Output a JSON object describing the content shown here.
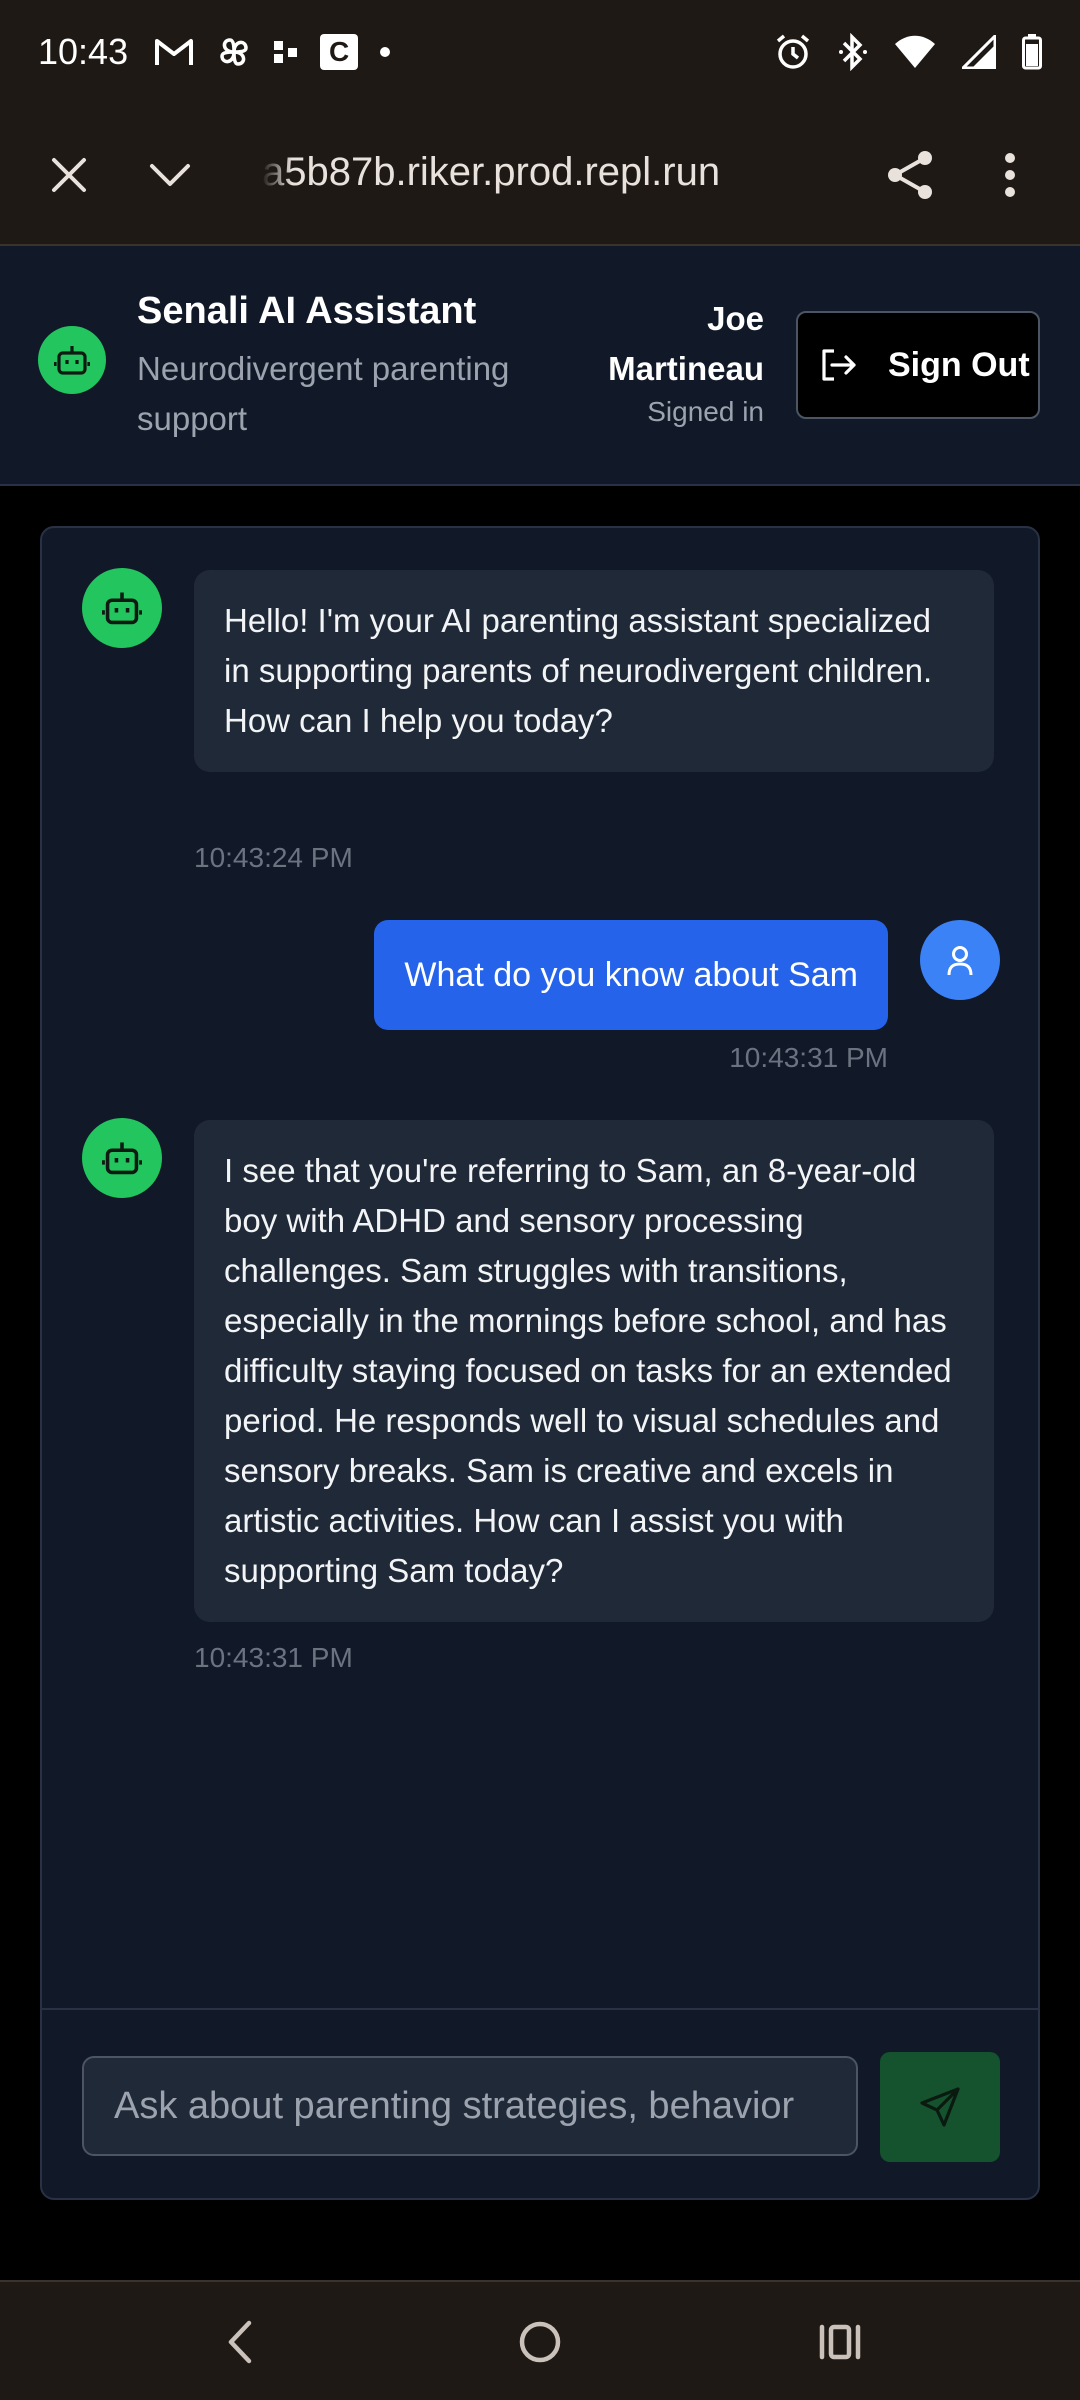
{
  "status_bar": {
    "time": "10:43",
    "left_icons": [
      "gmail-icon",
      "pinwheel-icon",
      "dots-app-icon",
      "c-app-icon",
      "notification-dot-icon"
    ],
    "c_app_letter": "C",
    "right_icons": [
      "alarm-icon",
      "bluetooth-icon",
      "wifi-icon",
      "signal-icon",
      "battery-icon"
    ]
  },
  "browser": {
    "url": "a5b87b.riker.prod.repl.run",
    "close_icon": "close-icon",
    "tabs_icon": "chevron-down-icon",
    "share_icon": "share-icon",
    "menu_icon": "more-vert-icon"
  },
  "header": {
    "title": "Senali AI Assistant",
    "subtitle": "Neurodivergent parenting support",
    "user_name": "Joe Martineau",
    "user_status": "Signed in",
    "sign_out_label": "Sign Out"
  },
  "messages": [
    {
      "role": "assistant",
      "text": "Hello! I'm your AI parenting assistant specialized in supporting parents of neurodivergent children. How can I help you today?",
      "time": "10:43:24 PM"
    },
    {
      "role": "user",
      "text": "What do you know about Sam",
      "time": "10:43:31 PM"
    },
    {
      "role": "assistant",
      "text": "I see that you're referring to Sam, an 8-year-old boy with ADHD and sensory processing challenges. Sam struggles with transitions, especially in the mornings before school, and has difficulty staying focused on tasks for an extended period. He responds well to visual schedules and sensory breaks. Sam is creative and excels in artistic activities. How can I assist you with supporting Sam today?",
      "time": "10:43:31 PM"
    }
  ],
  "composer": {
    "placeholder": "Ask about parenting strategies, behavior",
    "value": ""
  },
  "colors": {
    "accent_green": "#22c55e",
    "user_bubble": "#2563eb",
    "panel_bg": "#111827",
    "bubble_bg": "#1f2937"
  },
  "nav": {
    "icons": [
      "back-icon",
      "home-icon",
      "recents-icon"
    ]
  }
}
